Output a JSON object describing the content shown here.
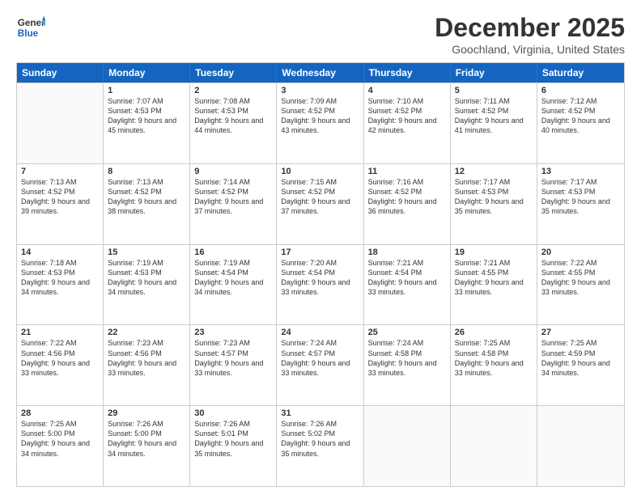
{
  "header": {
    "logo_line1": "General",
    "logo_line2": "Blue",
    "title": "December 2025",
    "subtitle": "Goochland, Virginia, United States"
  },
  "days": [
    "Sunday",
    "Monday",
    "Tuesday",
    "Wednesday",
    "Thursday",
    "Friday",
    "Saturday"
  ],
  "weeks": [
    [
      {
        "day": null
      },
      {
        "day": "1",
        "sunrise": "7:07 AM",
        "sunset": "4:53 PM",
        "daylight": "9 hours and 45 minutes."
      },
      {
        "day": "2",
        "sunrise": "7:08 AM",
        "sunset": "4:53 PM",
        "daylight": "9 hours and 44 minutes."
      },
      {
        "day": "3",
        "sunrise": "7:09 AM",
        "sunset": "4:52 PM",
        "daylight": "9 hours and 43 minutes."
      },
      {
        "day": "4",
        "sunrise": "7:10 AM",
        "sunset": "4:52 PM",
        "daylight": "9 hours and 42 minutes."
      },
      {
        "day": "5",
        "sunrise": "7:11 AM",
        "sunset": "4:52 PM",
        "daylight": "9 hours and 41 minutes."
      },
      {
        "day": "6",
        "sunrise": "7:12 AM",
        "sunset": "4:52 PM",
        "daylight": "9 hours and 40 minutes."
      }
    ],
    [
      {
        "day": "7",
        "sunrise": "7:13 AM",
        "sunset": "4:52 PM",
        "daylight": "9 hours and 39 minutes."
      },
      {
        "day": "8",
        "sunrise": "7:13 AM",
        "sunset": "4:52 PM",
        "daylight": "9 hours and 38 minutes."
      },
      {
        "day": "9",
        "sunrise": "7:14 AM",
        "sunset": "4:52 PM",
        "daylight": "9 hours and 37 minutes."
      },
      {
        "day": "10",
        "sunrise": "7:15 AM",
        "sunset": "4:52 PM",
        "daylight": "9 hours and 37 minutes."
      },
      {
        "day": "11",
        "sunrise": "7:16 AM",
        "sunset": "4:52 PM",
        "daylight": "9 hours and 36 minutes."
      },
      {
        "day": "12",
        "sunrise": "7:17 AM",
        "sunset": "4:53 PM",
        "daylight": "9 hours and 35 minutes."
      },
      {
        "day": "13",
        "sunrise": "7:17 AM",
        "sunset": "4:53 PM",
        "daylight": "9 hours and 35 minutes."
      }
    ],
    [
      {
        "day": "14",
        "sunrise": "7:18 AM",
        "sunset": "4:53 PM",
        "daylight": "9 hours and 34 minutes."
      },
      {
        "day": "15",
        "sunrise": "7:19 AM",
        "sunset": "4:53 PM",
        "daylight": "9 hours and 34 minutes."
      },
      {
        "day": "16",
        "sunrise": "7:19 AM",
        "sunset": "4:54 PM",
        "daylight": "9 hours and 34 minutes."
      },
      {
        "day": "17",
        "sunrise": "7:20 AM",
        "sunset": "4:54 PM",
        "daylight": "9 hours and 33 minutes."
      },
      {
        "day": "18",
        "sunrise": "7:21 AM",
        "sunset": "4:54 PM",
        "daylight": "9 hours and 33 minutes."
      },
      {
        "day": "19",
        "sunrise": "7:21 AM",
        "sunset": "4:55 PM",
        "daylight": "9 hours and 33 minutes."
      },
      {
        "day": "20",
        "sunrise": "7:22 AM",
        "sunset": "4:55 PM",
        "daylight": "9 hours and 33 minutes."
      }
    ],
    [
      {
        "day": "21",
        "sunrise": "7:22 AM",
        "sunset": "4:56 PM",
        "daylight": "9 hours and 33 minutes."
      },
      {
        "day": "22",
        "sunrise": "7:23 AM",
        "sunset": "4:56 PM",
        "daylight": "9 hours and 33 minutes."
      },
      {
        "day": "23",
        "sunrise": "7:23 AM",
        "sunset": "4:57 PM",
        "daylight": "9 hours and 33 minutes."
      },
      {
        "day": "24",
        "sunrise": "7:24 AM",
        "sunset": "4:57 PM",
        "daylight": "9 hours and 33 minutes."
      },
      {
        "day": "25",
        "sunrise": "7:24 AM",
        "sunset": "4:58 PM",
        "daylight": "9 hours and 33 minutes."
      },
      {
        "day": "26",
        "sunrise": "7:25 AM",
        "sunset": "4:58 PM",
        "daylight": "9 hours and 33 minutes."
      },
      {
        "day": "27",
        "sunrise": "7:25 AM",
        "sunset": "4:59 PM",
        "daylight": "9 hours and 34 minutes."
      }
    ],
    [
      {
        "day": "28",
        "sunrise": "7:25 AM",
        "sunset": "5:00 PM",
        "daylight": "9 hours and 34 minutes."
      },
      {
        "day": "29",
        "sunrise": "7:26 AM",
        "sunset": "5:00 PM",
        "daylight": "9 hours and 34 minutes."
      },
      {
        "day": "30",
        "sunrise": "7:26 AM",
        "sunset": "5:01 PM",
        "daylight": "9 hours and 35 minutes."
      },
      {
        "day": "31",
        "sunrise": "7:26 AM",
        "sunset": "5:02 PM",
        "daylight": "9 hours and 35 minutes."
      },
      {
        "day": null
      },
      {
        "day": null
      },
      {
        "day": null
      }
    ]
  ]
}
